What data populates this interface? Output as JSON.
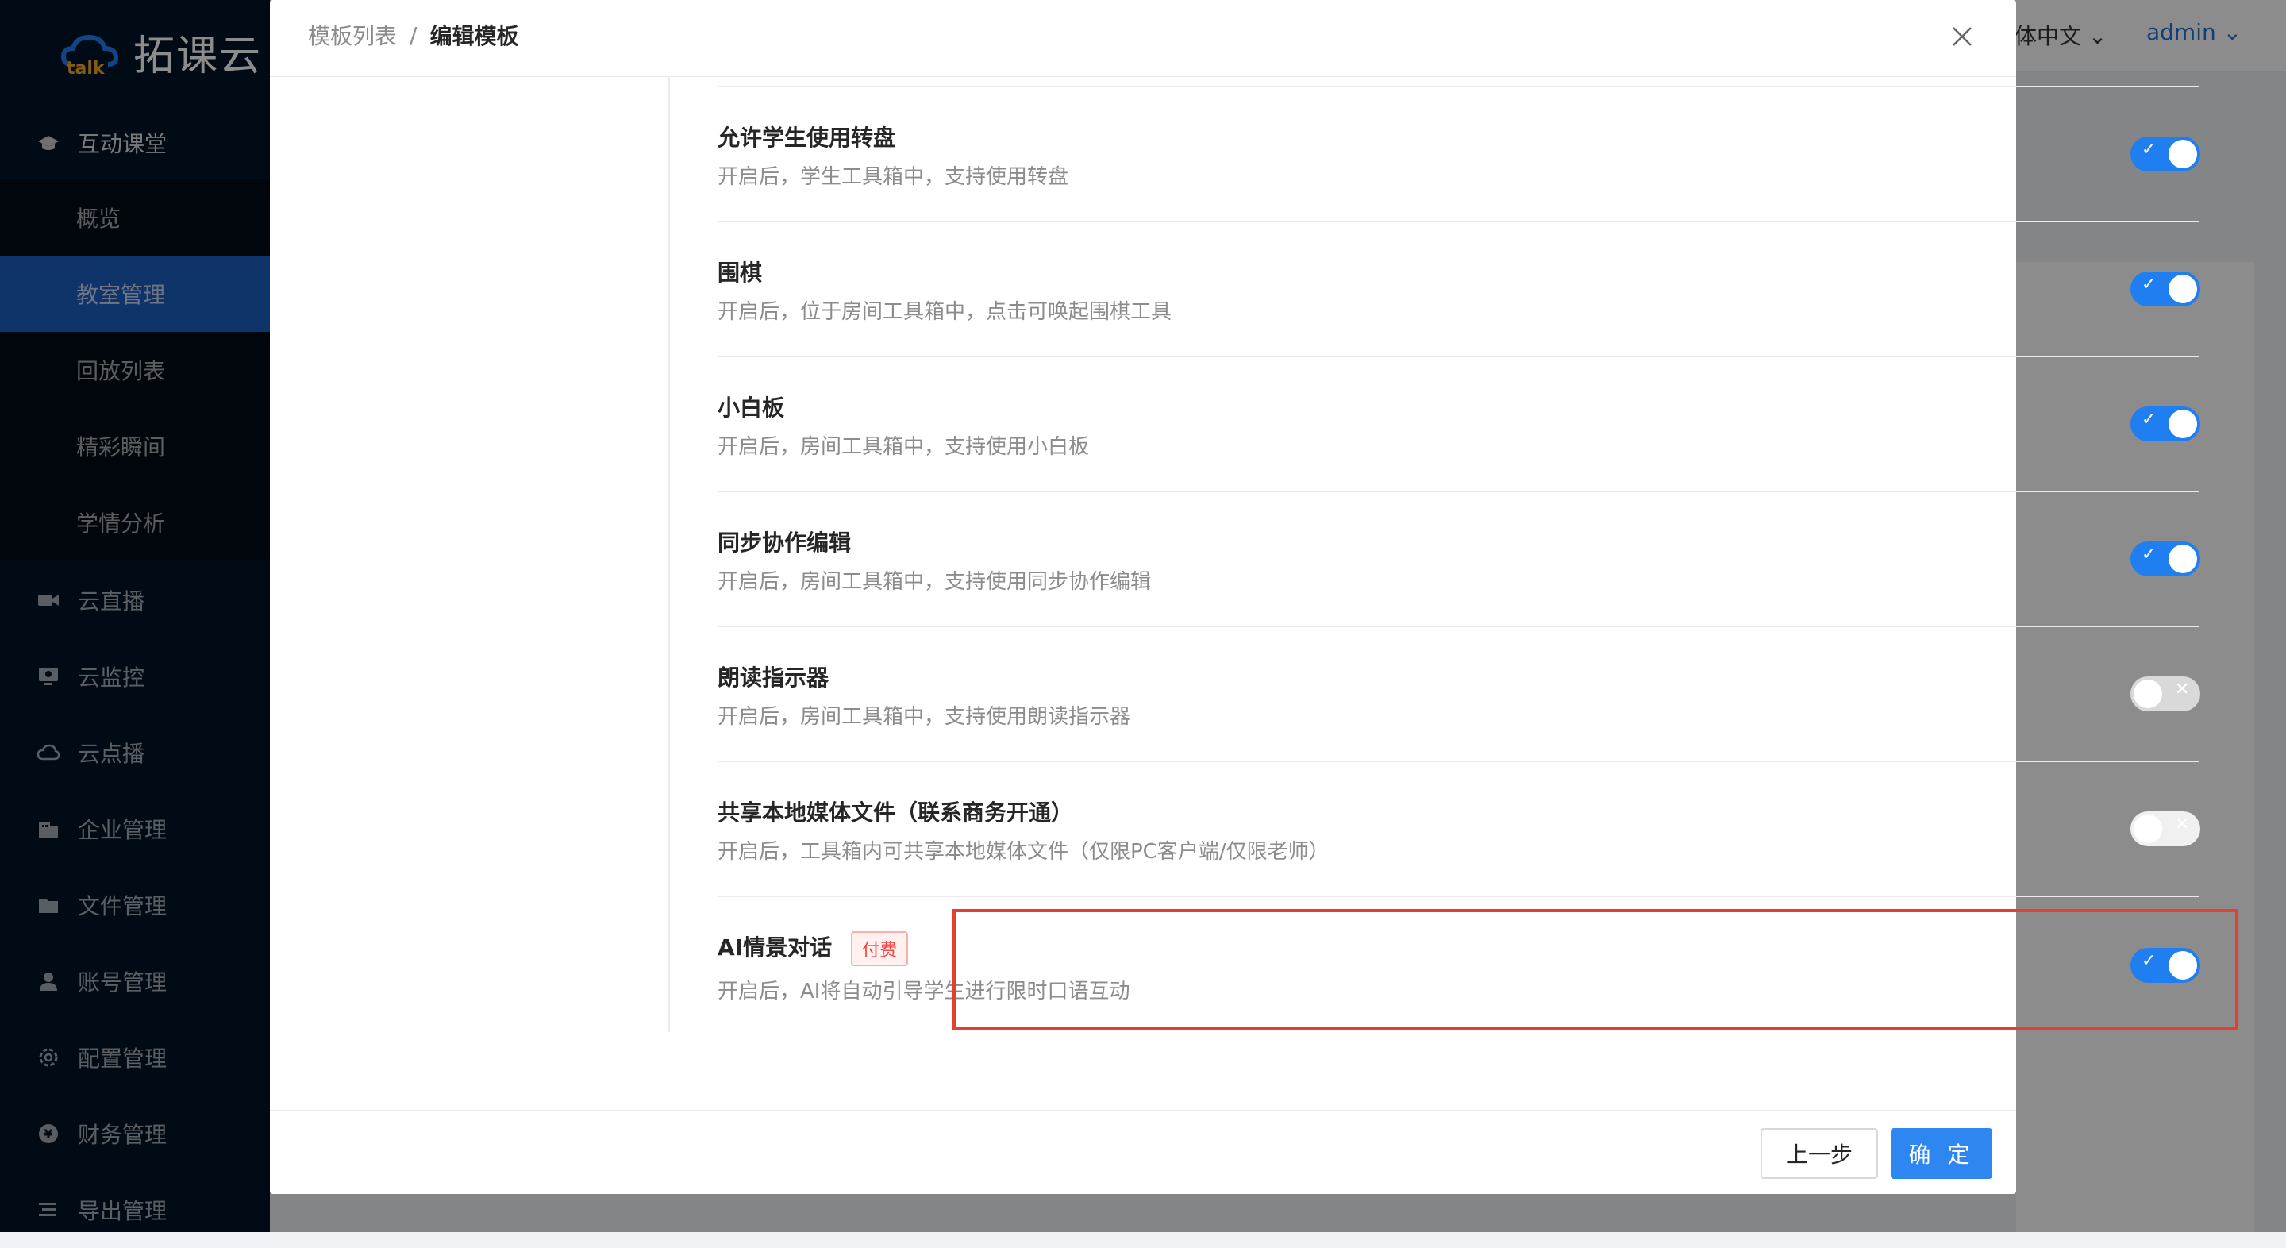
{
  "app": {
    "logo_text": "拓课云"
  },
  "sidebar": {
    "group": {
      "label": "互动课堂",
      "icon": "graduation-cap-icon"
    },
    "submenu": [
      {
        "label": "概览",
        "active": false
      },
      {
        "label": "教室管理",
        "active": true
      },
      {
        "label": "回放列表",
        "active": false
      },
      {
        "label": "精彩瞬间",
        "active": false
      },
      {
        "label": "学情分析",
        "active": false
      }
    ],
    "items": [
      {
        "label": "云直播",
        "icon": "video-camera-icon"
      },
      {
        "label": "云监控",
        "icon": "monitor-icon"
      },
      {
        "label": "云点播",
        "icon": "cloud-icon"
      },
      {
        "label": "企业管理",
        "icon": "building-icon"
      },
      {
        "label": "文件管理",
        "icon": "folder-icon"
      },
      {
        "label": "账号管理",
        "icon": "user-icon"
      },
      {
        "label": "配置管理",
        "icon": "gear-icon"
      },
      {
        "label": "财务管理",
        "icon": "yen-icon"
      },
      {
        "label": "导出管理",
        "icon": "export-icon"
      }
    ]
  },
  "header": {
    "language": "体中文",
    "user": "admin"
  },
  "modal": {
    "breadcrumb": {
      "prev": "模板列表",
      "sep": "/",
      "current": "编辑模板"
    },
    "settings": [
      {
        "title": "允许学生使用转盘",
        "desc": "开启后，学生工具箱中，支持使用转盘",
        "state": "on"
      },
      {
        "title": "围棋",
        "desc": "开启后，位于房间工具箱中，点击可唤起围棋工具",
        "state": "on"
      },
      {
        "title": "小白板",
        "desc": "开启后，房间工具箱中，支持使用小白板",
        "state": "on"
      },
      {
        "title": "同步协作编辑",
        "desc": "开启后，房间工具箱中，支持使用同步协作编辑",
        "state": "on"
      },
      {
        "title": "朗读指示器",
        "desc": "开启后，房间工具箱中，支持使用朗读指示器",
        "state": "off"
      },
      {
        "title": "共享本地媒体文件（联系商务开通）",
        "desc": "开启后，工具箱内可共享本地媒体文件（仅限PC客户端/仅限老师）",
        "state": "disabled"
      },
      {
        "title": "AI情景对话",
        "badge": "付费",
        "desc": "开启后，AI将自动引导学生进行限时口语互动",
        "state": "on"
      }
    ],
    "footer": {
      "prev_label": "上一步",
      "ok_label": "确 定"
    }
  },
  "colors": {
    "primary": "#1f7ff0",
    "highlight_border": "#e5402f",
    "sidebar_bg": "#001529"
  }
}
